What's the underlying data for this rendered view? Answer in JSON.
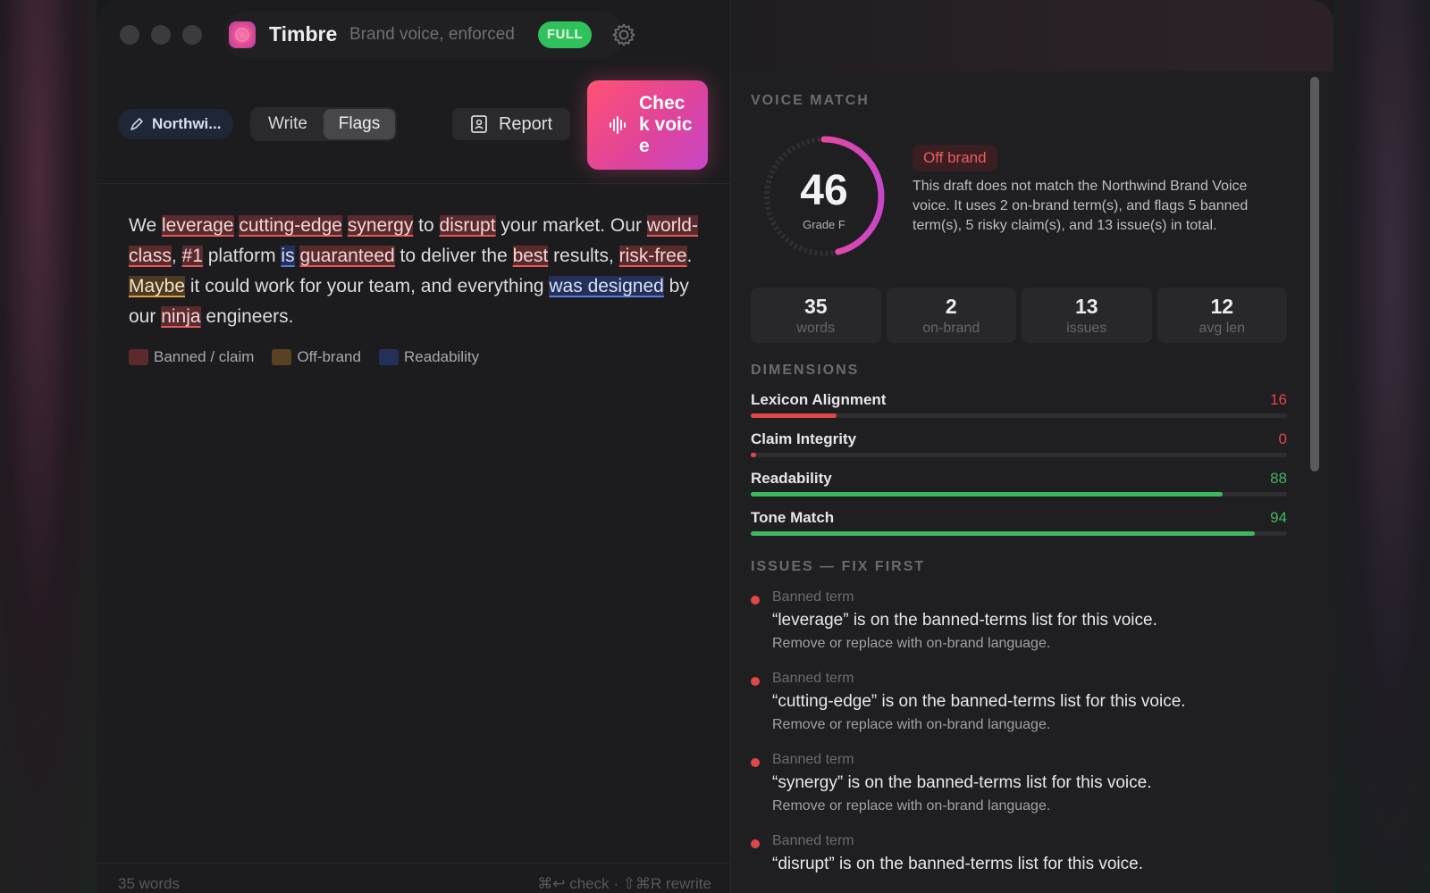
{
  "app": {
    "name": "Timbre",
    "tagline": "Brand voice, enforced",
    "plan_badge": "FULL"
  },
  "toolbar": {
    "voice_selector": "Northwi...",
    "mode_tabs": [
      {
        "label": "Write",
        "active": false
      },
      {
        "label": "Flags",
        "active": true
      }
    ],
    "report_label": "Report",
    "check_label": "Check voice"
  },
  "editor": {
    "segments": [
      {
        "t": "We ",
        "k": ""
      },
      {
        "t": "leverage",
        "k": "red"
      },
      {
        "t": " ",
        "k": ""
      },
      {
        "t": "cutting-edge",
        "k": "red"
      },
      {
        "t": " ",
        "k": ""
      },
      {
        "t": "synergy",
        "k": "red"
      },
      {
        "t": " to ",
        "k": ""
      },
      {
        "t": "disrupt",
        "k": "red"
      },
      {
        "t": " your market. Our ",
        "k": ""
      },
      {
        "t": "world-class",
        "k": "red"
      },
      {
        "t": ", ",
        "k": ""
      },
      {
        "t": "#1",
        "k": "red"
      },
      {
        "t": " platform ",
        "k": ""
      },
      {
        "t": "is",
        "k": "blue"
      },
      {
        "t": " ",
        "k": ""
      },
      {
        "t": "guaranteed",
        "k": "red"
      },
      {
        "t": " to deliver the ",
        "k": ""
      },
      {
        "t": "best",
        "k": "red"
      },
      {
        "t": " results, ",
        "k": ""
      },
      {
        "t": "risk-free",
        "k": "red"
      },
      {
        "t": ". ",
        "k": ""
      },
      {
        "t": "Maybe",
        "k": "orange"
      },
      {
        "t": " it could work for your team, and everything ",
        "k": ""
      },
      {
        "t": "was designed",
        "k": "blue"
      },
      {
        "t": " by our ",
        "k": ""
      },
      {
        "t": "ninja",
        "k": "red"
      },
      {
        "t": " engineers.",
        "k": ""
      }
    ],
    "legend": [
      {
        "label": "Banned / claim",
        "color": "#5a2a2c"
      },
      {
        "label": "Off-brand",
        "color": "#5a4024"
      },
      {
        "label": "Readability",
        "color": "#24305a"
      }
    ]
  },
  "footer": {
    "word_count": "35 words",
    "shortcuts": "⌘↩ check · ⇧⌘R rewrite"
  },
  "panel": {
    "voice_match_title": "VOICE MATCH",
    "score": "46",
    "score_fraction": 0.46,
    "grade": "Grade F",
    "status": "Off brand",
    "summary": "This draft does not match the Northwind Brand Voice voice. It uses 2 on-brand term(s), and flags 5 banned term(s), 5 risky claim(s), and 13 issue(s) in total.",
    "stats": [
      {
        "value": "35",
        "label": "words"
      },
      {
        "value": "2",
        "label": "on-brand"
      },
      {
        "value": "13",
        "label": "issues"
      },
      {
        "value": "12",
        "label": "avg len"
      }
    ],
    "dimensions_title": "DIMENSIONS",
    "dimensions": [
      {
        "name": "Lexicon Alignment",
        "score": "16",
        "value": 16,
        "color": "#e04848"
      },
      {
        "name": "Claim Integrity",
        "score": "0",
        "value": 0,
        "color": "#e04848"
      },
      {
        "name": "Readability",
        "score": "88",
        "value": 88,
        "color": "#3db85e"
      },
      {
        "name": "Tone Match",
        "score": "94",
        "value": 94,
        "color": "#3db85e"
      }
    ],
    "issues_title": "ISSUES — FIX FIRST",
    "issues": [
      {
        "type": "Banned term",
        "text": "“leverage” is on the banned-terms list for this voice.",
        "fix": "Remove or replace with on-brand language."
      },
      {
        "type": "Banned term",
        "text": "“cutting-edge” is on the banned-terms list for this voice.",
        "fix": "Remove or replace with on-brand language."
      },
      {
        "type": "Banned term",
        "text": "“synergy” is on the banned-terms list for this voice.",
        "fix": "Remove or replace with on-brand language."
      },
      {
        "type": "Banned term",
        "text": "“disrupt” is on the banned-terms list for this voice.",
        "fix": ""
      }
    ]
  },
  "colors": {
    "accent_pink": "#ff5275",
    "accent_purple": "#c746c8",
    "danger": "#e04848",
    "success": "#3db85e"
  },
  "icons": {
    "voice_selector": "pen-nib-icon",
    "report": "report-icon",
    "check": "waveform-icon",
    "settings": "gear-icon"
  }
}
